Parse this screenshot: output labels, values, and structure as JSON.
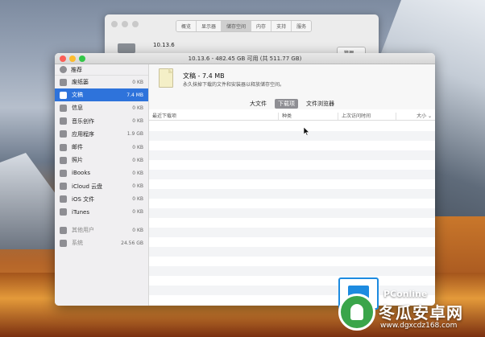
{
  "back_window": {
    "tabs": [
      "概览",
      "显示器",
      "储存空间",
      "内存",
      "支持",
      "服务"
    ],
    "selected_tab_index": 2,
    "version": "10.13.6",
    "button_label": "管理..."
  },
  "window": {
    "title": "10.13.6 - 482.45 GB 可用 (共 511.77 GB)",
    "recommend_label": "推荐"
  },
  "sidebar": {
    "items": [
      {
        "label": "废纸篓",
        "size": "0 KB",
        "icon": "trash-icon"
      },
      {
        "label": "文稿",
        "size": "7.4 MB",
        "icon": "document-icon",
        "selected": true
      },
      {
        "label": "信息",
        "size": "0 KB",
        "icon": "messages-icon"
      },
      {
        "label": "音乐创作",
        "size": "0 KB",
        "icon": "guitar-icon"
      },
      {
        "label": "应用程序",
        "size": "1.9 GB",
        "icon": "applications-icon"
      },
      {
        "label": "邮件",
        "size": "0 KB",
        "icon": "mail-icon"
      },
      {
        "label": "照片",
        "size": "0 KB",
        "icon": "photos-icon"
      },
      {
        "label": "iBooks",
        "size": "0 KB",
        "icon": "ibooks-icon"
      },
      {
        "label": "iCloud 云盘",
        "size": "0 KB",
        "icon": "icloud-icon"
      },
      {
        "label": "iOS 文件",
        "size": "0 KB",
        "icon": "ios-files-icon"
      },
      {
        "label": "iTunes",
        "size": "0 KB",
        "icon": "itunes-icon"
      }
    ],
    "other_items": [
      {
        "label": "其他用户",
        "size": "0 KB",
        "icon": "users-icon"
      },
      {
        "label": "系统",
        "size": "24.56 GB",
        "icon": "gear-icon"
      }
    ]
  },
  "main": {
    "title": "文稿 - 7.4 MB",
    "description": "永久抹掉下载的文件和安装器以释放储存空间。",
    "tabs": [
      "大文件",
      "下载项",
      "文件浏览器"
    ],
    "selected_tab_index": 1,
    "columns": [
      "最近下载项",
      "种类",
      "上次访问时间",
      "大小 ⌄"
    ]
  },
  "watermark": {
    "brand": "PConline",
    "site_name": "冬瓜安卓网",
    "url": "www.dgxcdz168.com"
  }
}
